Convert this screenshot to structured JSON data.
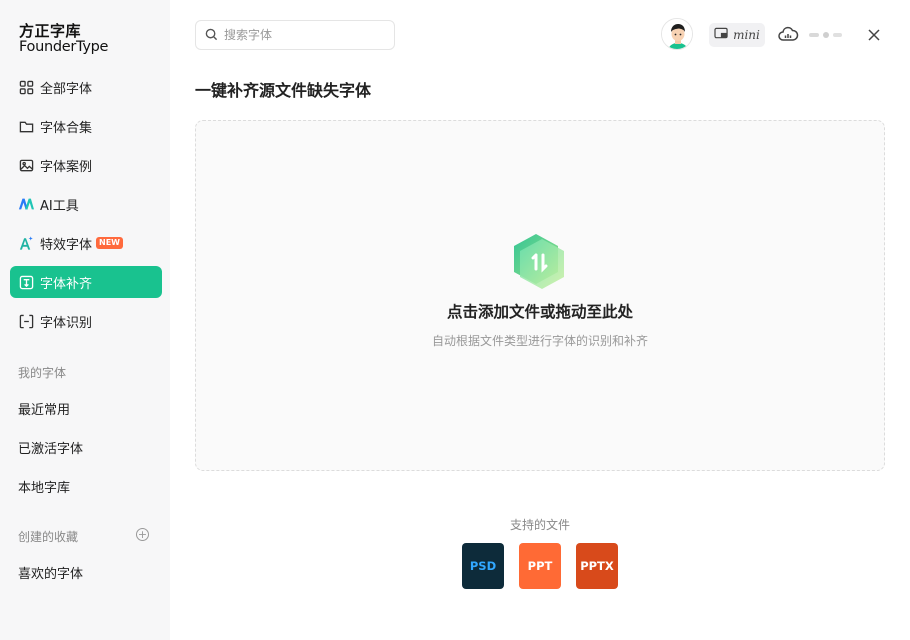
{
  "app": {
    "logo_line1": "方正字库",
    "logo_line2": "FounderType"
  },
  "sidebar": {
    "items": [
      {
        "label": "全部字体"
      },
      {
        "label": "字体合集"
      },
      {
        "label": "字体案例"
      },
      {
        "label": "AI工具"
      },
      {
        "label": "特效字体",
        "badge": "NEW"
      },
      {
        "label": "字体补齐"
      },
      {
        "label": "字体识别"
      }
    ],
    "my_fonts_title": "我的字体",
    "my_fonts": [
      "最近常用",
      "已激活字体",
      "本地字库"
    ],
    "collections_title": "创建的收藏",
    "collections": [
      "喜欢的字体"
    ]
  },
  "header": {
    "search_placeholder": "搜索字体",
    "mini_label": "mini"
  },
  "main": {
    "title": "一键补齐源文件缺失字体",
    "drop_title": "点击添加文件或拖动至此处",
    "drop_subtitle": "自动根据文件类型进行字体的识别和补齐",
    "supported_label": "支持的文件",
    "file_types": [
      "PSD",
      "PPT",
      "PPTX"
    ]
  },
  "colors": {
    "accent": "#19c28f",
    "psd_bg": "#0d2b3a",
    "psd_text": "#31a8ff",
    "ppt_bg": "#ff6a35",
    "pptx_bg": "#d84a1b",
    "new_badge": "#ff6a3d"
  }
}
